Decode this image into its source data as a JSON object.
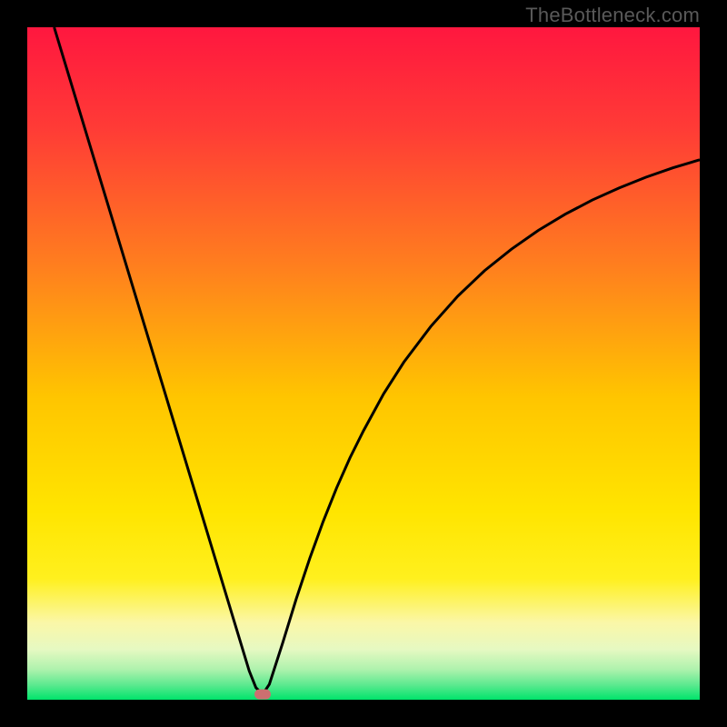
{
  "watermark": "TheBottleneck.com",
  "chart_data": {
    "type": "line",
    "title": "",
    "xlabel": "",
    "ylabel": "",
    "xlim": [
      0,
      100
    ],
    "ylim": [
      0,
      100
    ],
    "gradient_stops": [
      {
        "offset": 0.0,
        "color": "#ff173f"
      },
      {
        "offset": 0.15,
        "color": "#ff3b36"
      },
      {
        "offset": 0.35,
        "color": "#ff7d1f"
      },
      {
        "offset": 0.55,
        "color": "#ffc500"
      },
      {
        "offset": 0.72,
        "color": "#ffe500"
      },
      {
        "offset": 0.82,
        "color": "#fff01e"
      },
      {
        "offset": 0.885,
        "color": "#fbf7a7"
      },
      {
        "offset": 0.925,
        "color": "#e6f9c2"
      },
      {
        "offset": 0.955,
        "color": "#aef2ad"
      },
      {
        "offset": 0.978,
        "color": "#5ce98f"
      },
      {
        "offset": 1.0,
        "color": "#00e46b"
      }
    ],
    "series": [
      {
        "name": "bottleneck-curve",
        "color": "#000000",
        "x": [
          4,
          6,
          8,
          10,
          12,
          14,
          16,
          18,
          20,
          22,
          24,
          26,
          28,
          30,
          31.5,
          33,
          34,
          35,
          36,
          38,
          40,
          42,
          44,
          46,
          48,
          50,
          53,
          56,
          60,
          64,
          68,
          72,
          76,
          80,
          84,
          88,
          92,
          96,
          100
        ],
        "y": [
          100,
          93.4,
          86.8,
          80.2,
          73.6,
          67,
          60.4,
          53.8,
          47.2,
          40.6,
          34,
          27.4,
          20.8,
          14.2,
          9.25,
          4.3,
          1.8,
          0.8,
          2.3,
          8.5,
          15,
          21,
          26.5,
          31.5,
          36,
          40,
          45.5,
          50.2,
          55.5,
          60,
          63.8,
          67,
          69.8,
          72.2,
          74.3,
          76.1,
          77.7,
          79.1,
          80.3
        ]
      }
    ],
    "marker": {
      "x": 35,
      "y": 0.8,
      "color": "#cc6f70"
    }
  }
}
